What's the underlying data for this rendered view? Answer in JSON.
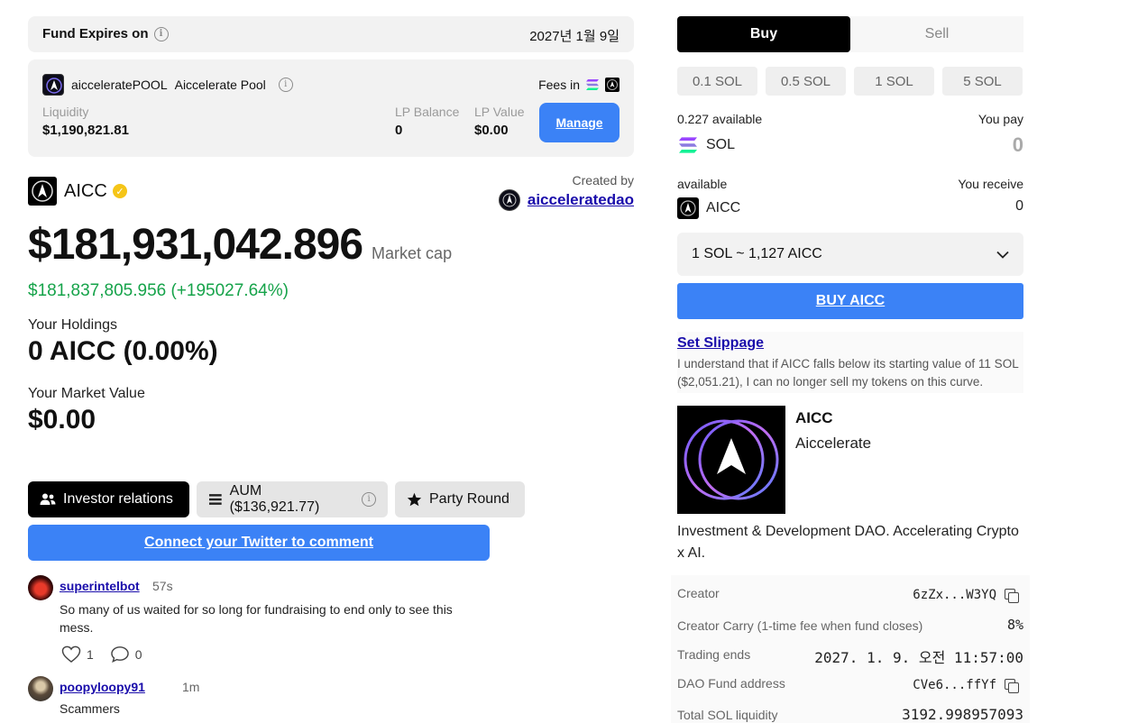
{
  "fund": {
    "label": "Fund Expires on",
    "date": "2027년 1월 9일"
  },
  "pool": {
    "name": "aicceleratePOOL",
    "title": "Aiccelerate Pool",
    "fees_label": "Fees in",
    "liquidity_label": "Liquidity",
    "liquidity": "$1,190,821.81",
    "lp_balance_label": "LP Balance",
    "lp_balance": "0",
    "lp_value_label": "LP Value",
    "lp_value": "$0.00",
    "manage_label": "Manage"
  },
  "token": {
    "symbol": "AICC",
    "name": "Aiccelerate",
    "created_by_label": "Created by",
    "creator_handle": "aicceleratedao",
    "market_cap": "$181,931,042.896",
    "market_cap_label": "Market cap",
    "market_cap_change": "$181,837,805.956 (+195027.64%)",
    "description": "Investment & Development DAO. Accelerating Crypto x AI."
  },
  "holdings": {
    "label": "Your Holdings",
    "value": "0 AICC (0.00%)",
    "market_value_label": "Your Market Value",
    "market_value": "$0.00"
  },
  "tabs": [
    {
      "label": "Investor relations",
      "icon": "users-icon"
    },
    {
      "label": "AUM ($136,921.77)",
      "icon": "list-icon"
    },
    {
      "label": "Party Round",
      "icon": "star-icon"
    }
  ],
  "twitter_button": "Connect your Twitter to comment",
  "comments": [
    {
      "user": "superintelbot",
      "time": "57s",
      "text": "So many of us waited for so long for fundraising to end only to see this mess.",
      "likes": "1",
      "replies": "0"
    },
    {
      "user": "poopyloopy91",
      "time": "1m",
      "text": "Scammers"
    }
  ],
  "trade": {
    "buy_label": "Buy",
    "sell_label": "Sell",
    "amounts": [
      "0.1 SOL",
      "0.5 SOL",
      "1 SOL",
      "5 SOL"
    ],
    "pay_available": "0.227 available",
    "you_pay_label": "You pay",
    "pay_asset": "SOL",
    "pay_value": "0",
    "receive_available": "available",
    "you_receive_label": "You receive",
    "receive_asset": "AICC",
    "receive_value": "0",
    "rate": "1 SOL ~ 1,127 AICC",
    "buy_button": "BUY AICC",
    "slippage_link": "Set Slippage",
    "slippage_text": "I understand that if AICC falls below its starting value of 11 SOL ($2,051.21), I can no longer sell my tokens on this curve."
  },
  "info": [
    {
      "key": "Creator",
      "value": "6zZx...W3YQ",
      "copy": true
    },
    {
      "key": "Creator Carry (1-time fee when fund closes)",
      "value": "8%",
      "copy": false
    },
    {
      "key": "Trading ends",
      "value": "2027. 1. 9. 오전 11:57:00",
      "copy": false
    },
    {
      "key": "DAO Fund address",
      "value": "CVe6...ffYf",
      "copy": true
    },
    {
      "key": "Total SOL liquidity",
      "value": "3192.998957093",
      "copy": false
    }
  ],
  "colors": {
    "accent": "#3b82f6",
    "positive": "#16a34a",
    "link": "#1a0dab",
    "verified": "#f5c518"
  }
}
